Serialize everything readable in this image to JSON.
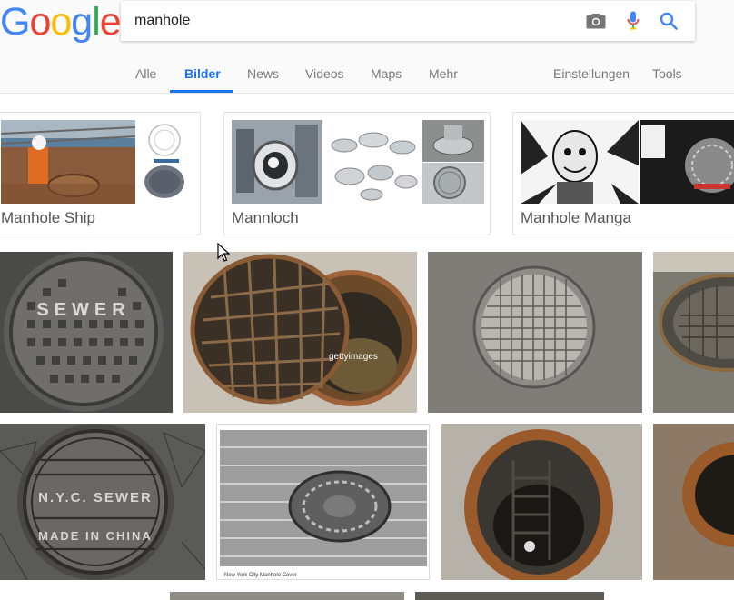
{
  "logo": {
    "letters": [
      "G",
      "o",
      "o",
      "g",
      "l",
      "e"
    ],
    "colors": [
      "#4285F4",
      "#EA4335",
      "#FBBC05",
      "#4285F4",
      "#34A853",
      "#EA4335"
    ]
  },
  "search": {
    "query": "manhole"
  },
  "icons": {
    "camera": "camera-icon",
    "mic": "microphone-icon",
    "search": "search-icon"
  },
  "tabs": {
    "all": "Alle",
    "images": "Bilder",
    "news": "News",
    "videos": "Videos",
    "maps": "Maps",
    "more": "Mehr",
    "settings": "Einstellungen",
    "tools": "Tools"
  },
  "suggestions": [
    {
      "label": "Manhole Ship"
    },
    {
      "label": "Mannloch"
    },
    {
      "label": "Manhole Manga"
    }
  ],
  "watermarks": {
    "getty": "gettyimages",
    "nyc_caption": "New York City Manhole Cover",
    "nyc_text": "N.Y.C. SEWER",
    "made_in": "MADE IN CHINA",
    "sewer": "SEWER"
  },
  "colors": {
    "accent": "#1a73e8",
    "tab_text": "#777777"
  }
}
